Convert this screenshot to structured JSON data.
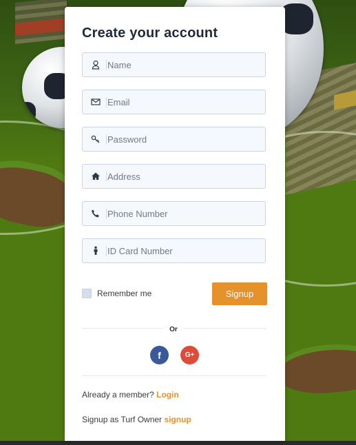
{
  "form": {
    "title": "Create your account",
    "fields": [
      {
        "icon": "user-icon",
        "placeholder": "Name"
      },
      {
        "icon": "envelope-icon",
        "placeholder": "Email"
      },
      {
        "icon": "key-icon",
        "placeholder": "Password"
      },
      {
        "icon": "home-icon",
        "placeholder": "Address"
      },
      {
        "icon": "phone-icon",
        "placeholder": "Phone Number"
      },
      {
        "icon": "person-icon",
        "placeholder": "ID Card Number"
      }
    ],
    "remember_label": "Remember me",
    "remember_checked": false,
    "signup_label": "Signup",
    "or_label": "Or",
    "social": {
      "facebook_label": "f",
      "google_label": "G+"
    },
    "already_member_text": "Already a member?",
    "login_label": "Login",
    "turf_owner_text": "Signup as Turf Owner",
    "turf_owner_link": "signup"
  },
  "colors": {
    "accent": "#e6922c",
    "title": "#1c2a3a",
    "facebook": "#3b5998",
    "google": "#dd4b39",
    "field_border": "#c8d4e6",
    "field_bg": "#f5f8fc"
  }
}
